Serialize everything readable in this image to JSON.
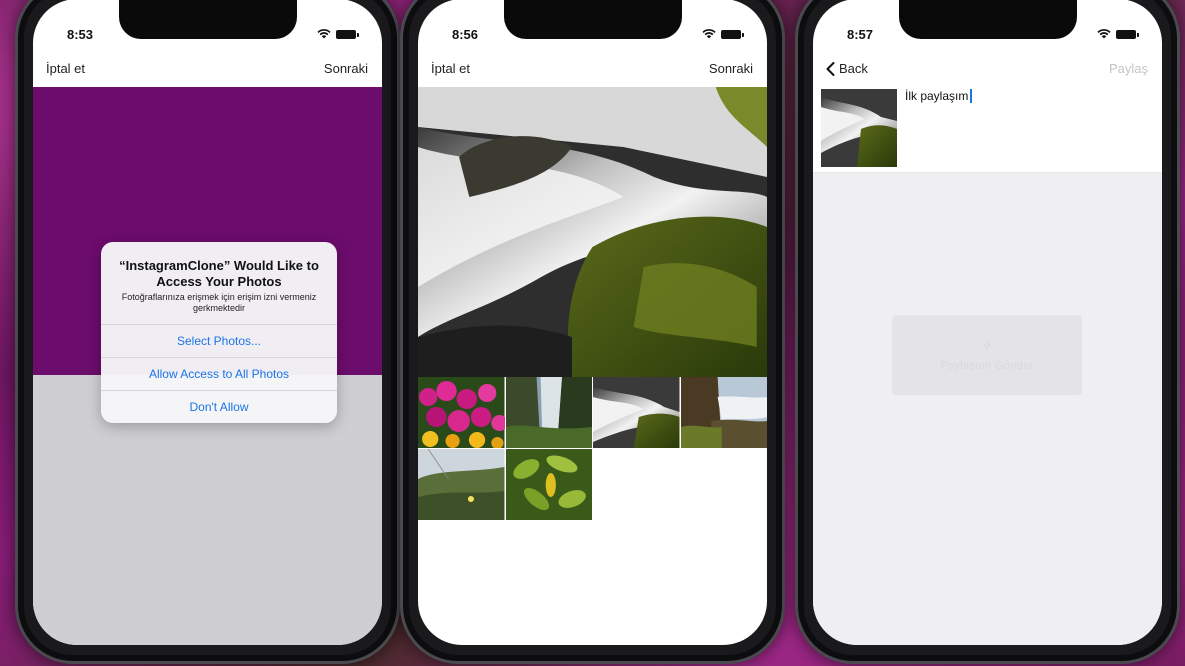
{
  "phones": [
    {
      "time": "8:53",
      "nav": {
        "left": "İptal et",
        "right": "Sonraki"
      },
      "alert": {
        "title": "“InstagramClone” Would Like to Access Your Photos",
        "message": "Fotoğraflarınıza erişmek için erişim izni vermeniz gerkmektedir",
        "buttons": [
          "Select Photos...",
          "Allow Access to All Photos",
          "Don't Allow"
        ]
      },
      "colors": {
        "top": "#6c0c6c",
        "bottom": "#cfcfd1"
      }
    },
    {
      "time": "8:56",
      "nav": {
        "left": "İptal et",
        "right": "Sonraki"
      },
      "photos": {
        "hero": "waterfall-rocks-photo",
        "thumbnails": [
          "pink-flowers-photo",
          "canyon-waterfall-photo",
          "waterfall-rocks-photo",
          "cliff-waterfall-photo",
          "hillside-field-photo",
          "green-leaves-photo"
        ]
      }
    },
    {
      "time": "8:57",
      "nav": {
        "back": "Back",
        "right": "Paylaş"
      },
      "caption": "İlk paylaşım",
      "share_button": {
        "label": "Paylaşımı Gönder",
        "icon": "sparkle-icon"
      }
    }
  ],
  "accent_color": "#1a74e8"
}
